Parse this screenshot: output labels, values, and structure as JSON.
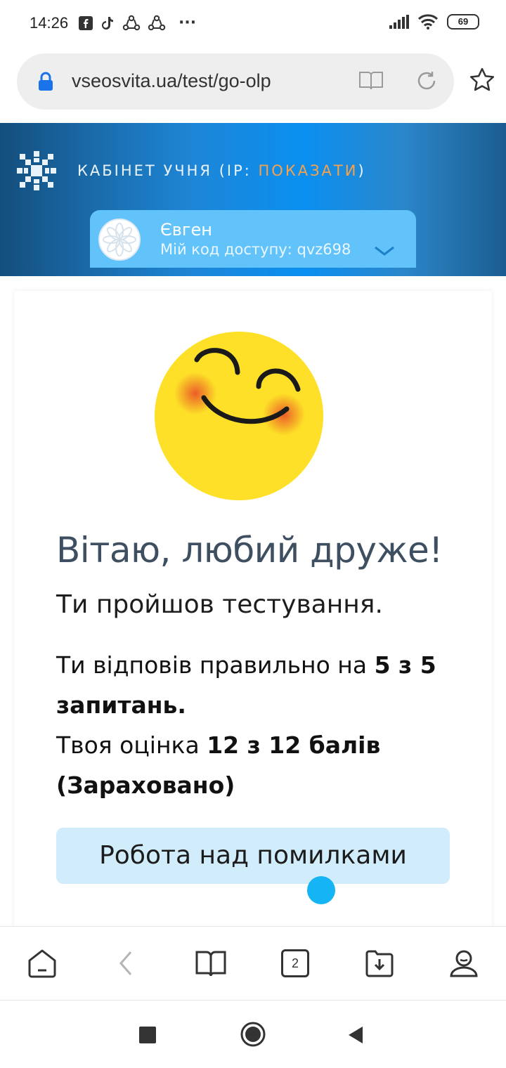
{
  "status_bar": {
    "time": "14:26",
    "more": "···",
    "battery": "69"
  },
  "browser": {
    "url": "vseosvita.ua/test/go-olp",
    "tab_count": "2"
  },
  "header": {
    "cabinet_label": "КАБІНЕТ УЧНЯ (IP: ",
    "show_ip_link": "ПОКАЗАТИ",
    "cabinet_close": ")",
    "user_name": "Євген",
    "access_code": "Мій код доступу: qvz698"
  },
  "result": {
    "greeting": "Вітаю, любий друже!",
    "passed": "Ти пройшов тестування.",
    "answered_prefix": "Ти відповів правильно на ",
    "answered_bold": "5 з 5 запитань.",
    "grade_prefix": "Твоя оцінка ",
    "grade_bold": "12 з 12 балів (Зараховано)",
    "mistakes_button": "Робота над помилками"
  },
  "colors": {
    "accent": "#f7a24b",
    "card_blue": "#62c3fb",
    "button_bg": "#d1ecfb"
  }
}
